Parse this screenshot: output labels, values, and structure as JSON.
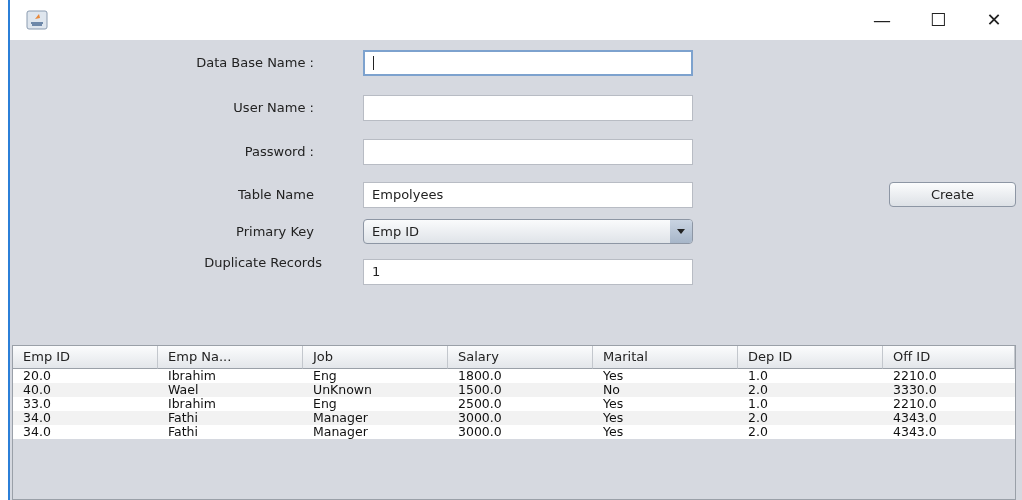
{
  "window": {
    "title_buttons": [
      "—",
      "☐",
      "✕"
    ]
  },
  "form": {
    "fields": [
      {
        "kind": "text",
        "label": "Data Base Name :",
        "focused": true
      },
      {
        "kind": "text",
        "label": "User Name :",
        "focused": false
      },
      {
        "kind": "text",
        "label": "Password :",
        "focused": false
      },
      {
        "kind": "text",
        "label": "Table Name",
        "value": "Empolyees",
        "focused": false
      },
      {
        "kind": "select",
        "label": "Primary Key",
        "value": "Emp ID"
      },
      {
        "kind": "text",
        "label": "Duplicate Records",
        "value": "1",
        "focused": false
      }
    ],
    "create_button": "Create"
  },
  "table": {
    "columns": [
      "Emp ID",
      "Emp Na...",
      "Job",
      "Salary",
      "Marital",
      "Dep ID",
      "Off ID"
    ],
    "rows": [
      [
        "20.0",
        "Ibrahim",
        "Eng",
        "1800.0",
        "Yes",
        "1.0",
        "2210.0"
      ],
      [
        "40.0",
        "Wael",
        "UnKnown",
        "1500.0",
        "No",
        "2.0",
        "3330.0"
      ],
      [
        "33.0",
        "Ibrahim",
        "Eng",
        "2500.0",
        "Yes",
        "1.0",
        "2210.0"
      ],
      [
        "34.0",
        "Fathi",
        "Manager",
        "3000.0",
        "Yes",
        "2.0",
        "4343.0"
      ],
      [
        "34.0",
        "Fathi",
        "Manager",
        "3000.0",
        "Yes",
        "2.0",
        "4343.0"
      ]
    ]
  }
}
